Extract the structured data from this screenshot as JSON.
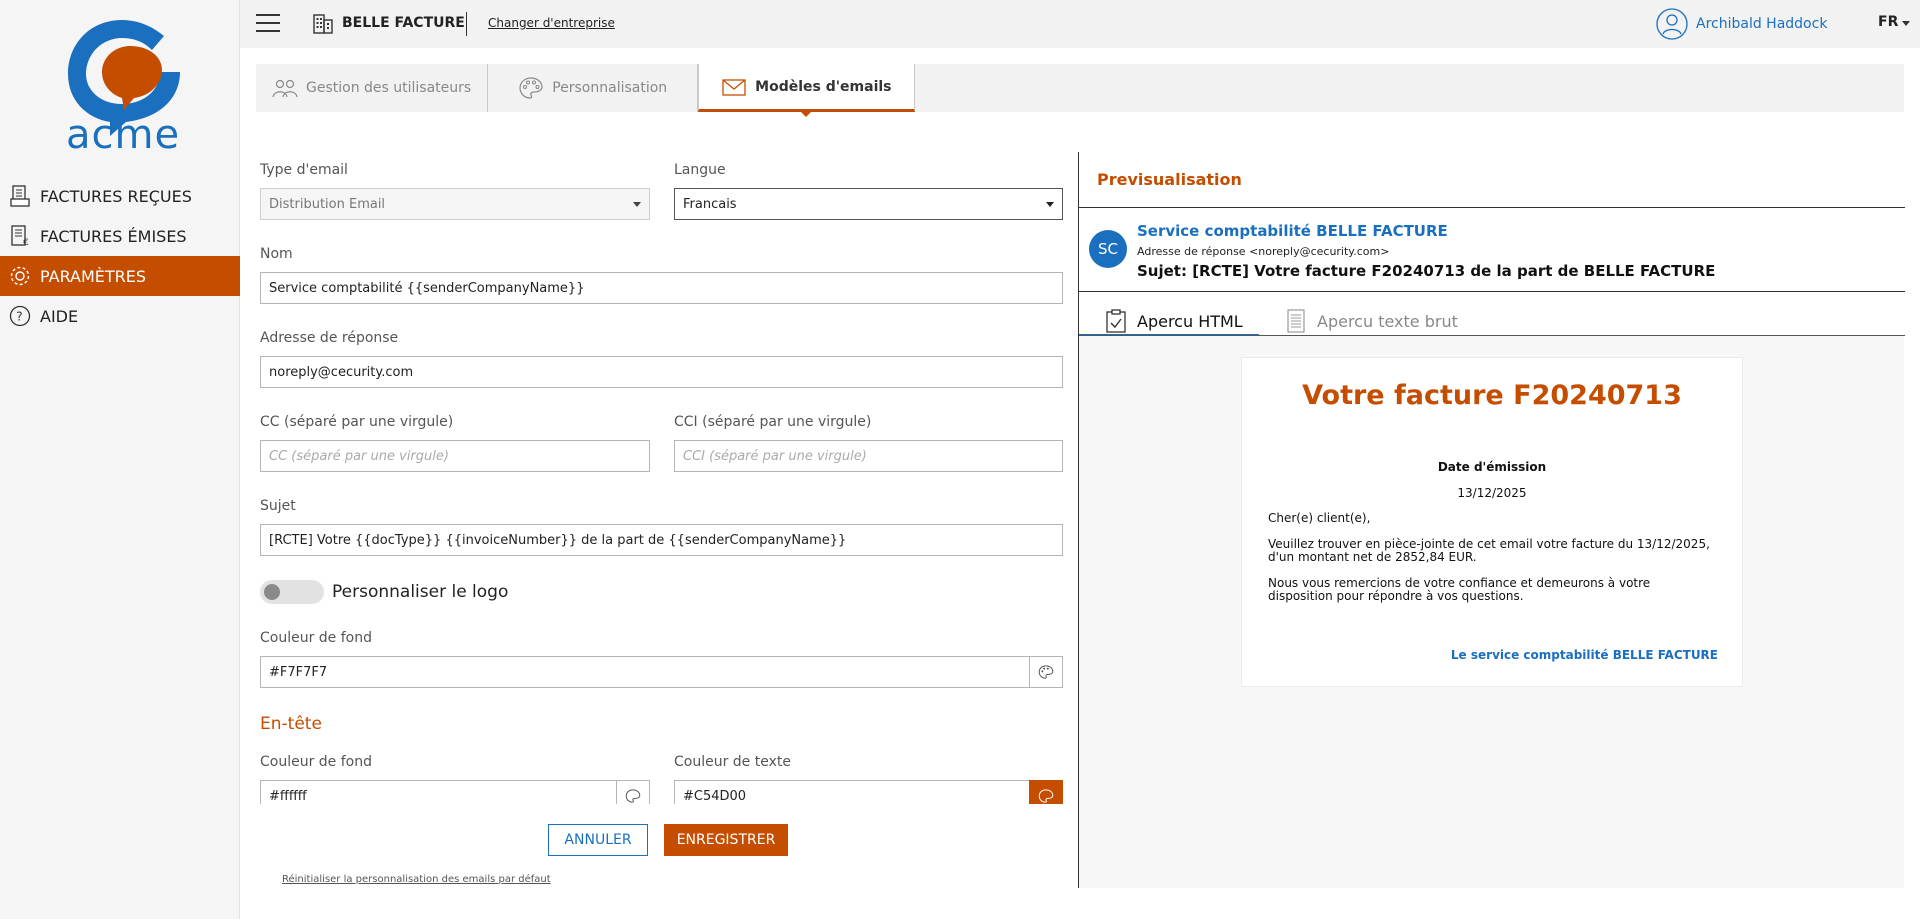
{
  "sidebar": {
    "logo_text": "acme",
    "items": [
      {
        "label": "FACTURES REÇUES",
        "icon": "received-invoices-icon"
      },
      {
        "label": "FACTURES ÉMISES",
        "icon": "issued-invoices-icon"
      },
      {
        "label": "PARAMÈTRES",
        "icon": "gear-icon"
      },
      {
        "label": "AIDE",
        "icon": "help-icon"
      }
    ]
  },
  "topbar": {
    "company_name": "BELLE FACTURE",
    "change_company": "Changer d'entreprise",
    "user_name": "Archibald Haddock",
    "language": "FR"
  },
  "tabs": [
    {
      "label": "Gestion des utilisateurs",
      "icon": "users-icon"
    },
    {
      "label": "Personnalisation",
      "icon": "palette-icon"
    },
    {
      "label": "Modèles d'emails",
      "icon": "envelope-icon"
    }
  ],
  "form": {
    "email_type_label": "Type d'email",
    "email_type_value": "Distribution Email",
    "language_label": "Langue",
    "language_value": "Francais",
    "name_label": "Nom",
    "name_value": "Service comptabilité {{senderCompanyName}}",
    "reply_label": "Adresse de réponse",
    "reply_value": "noreply@cecurity.com",
    "cc_label": "CC (séparé par une virgule)",
    "cc_placeholder": "CC (séparé par une virgule)",
    "cci_label": "CCI (séparé par une virgule)",
    "cci_placeholder": "CCI (séparé par une virgule)",
    "subject_label": "Sujet",
    "subject_value": "[RCTE] Votre {{docType}} {{invoiceNumber}} de la part de {{senderCompanyName}}",
    "logo_toggle_label": "Personnaliser le logo",
    "bg_color_label": "Couleur de fond",
    "bg_color_value": "#F7F7F7",
    "header_section": "En-tête",
    "header_bg_label": "Couleur de fond",
    "header_bg_value": "#ffffff",
    "header_text_label": "Couleur de texte",
    "header_text_value": "#C54D00",
    "cancel": "ANNULER",
    "save": "ENREGISTRER",
    "reset": "Réinitialiser la personnalisation des emails par défaut"
  },
  "preview": {
    "title": "Previsualisation",
    "avatar": "SC",
    "sender": "Service comptabilité BELLE FACTURE",
    "reply": "Adresse de réponse <noreply@cecurity.com>",
    "subject": "Sujet: [RCTE] Votre facture F20240713 de la part de BELLE FACTURE",
    "tab_html": "Apercu HTML",
    "tab_text": "Apercu texte brut",
    "email": {
      "title": "Votre facture F20240713",
      "date_label": "Date d'émission",
      "date_value": "13/12/2025",
      "greeting": "Cher(e) client(e),",
      "paragraph1": "Veuillez trouver en pièce-jointe de cet email votre facture du 13/12/2025, d'un montant net de 2852,84 EUR.",
      "paragraph2": "Nous vous remercions de votre confiance et demeurons à votre disposition pour répondre à vos questions.",
      "signature": "Le service comptabilité BELLE FACTURE"
    }
  },
  "colors": {
    "accent": "#C54D00",
    "brand_blue": "#1A6FBF"
  }
}
